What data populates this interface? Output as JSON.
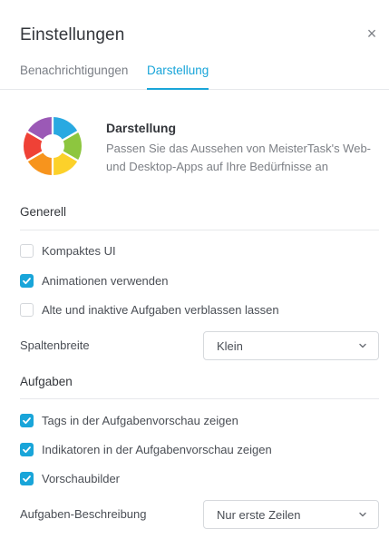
{
  "header": {
    "title": "Einstellungen",
    "close_icon": "×"
  },
  "tabs": [
    {
      "label": "Benachrichtigungen",
      "active": false
    },
    {
      "label": "Darstellung",
      "active": true
    }
  ],
  "intro": {
    "title": "Darstellung",
    "description": "Passen Sie das Aussehen von MeisterTask's Web- und Desktop-Apps auf Ihre Bedürfnisse an"
  },
  "general": {
    "heading": "Generell",
    "options": [
      {
        "label": "Kompaktes UI",
        "checked": false
      },
      {
        "label": "Animationen verwenden",
        "checked": true
      },
      {
        "label": "Alte und inaktive Aufgaben verblassen lassen",
        "checked": false
      }
    ],
    "column_width": {
      "label": "Spaltenbreite",
      "value": "Klein"
    }
  },
  "tasks": {
    "heading": "Aufgaben",
    "options": [
      {
        "label": "Tags in der Aufgabenvorschau zeigen",
        "checked": true
      },
      {
        "label": "Indikatoren in der Aufgabenvorschau zeigen",
        "checked": true
      },
      {
        "label": "Vorschaubilder",
        "checked": true
      }
    ],
    "description": {
      "label": "Aufgaben-Beschreibung",
      "value": "Nur erste Zeilen"
    }
  },
  "colors": {
    "accent": "#19a5d9",
    "logo_segments": [
      "#29a9e1",
      "#8dc63f",
      "#fcd12a",
      "#f7941d",
      "#ef4136",
      "#9b59b6"
    ]
  }
}
